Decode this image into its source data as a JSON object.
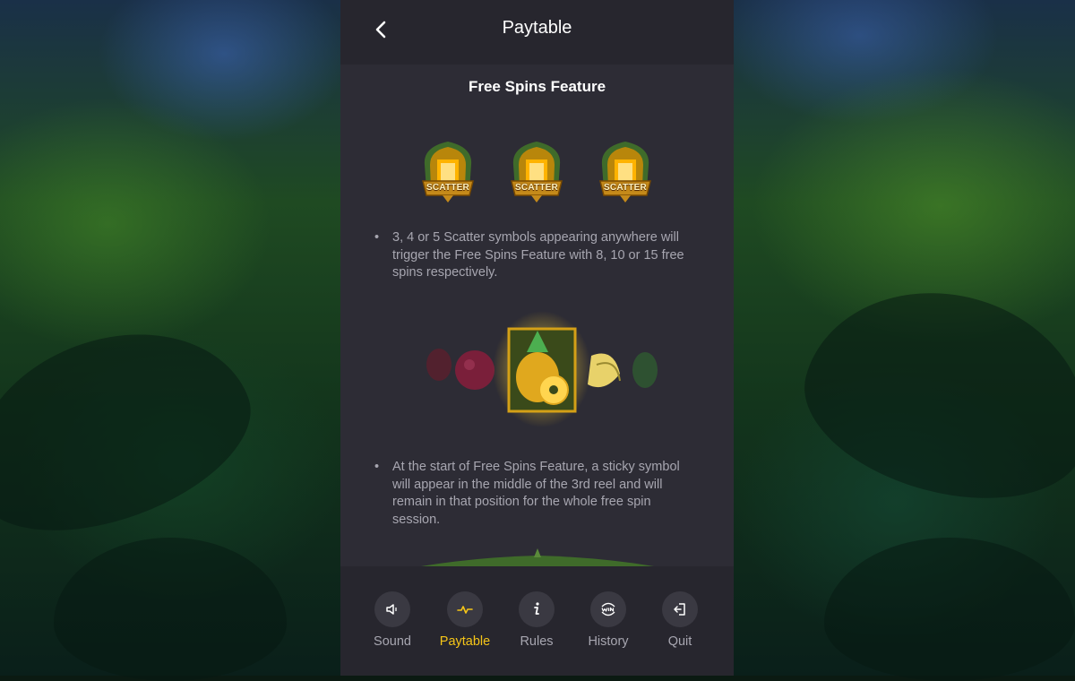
{
  "header": {
    "title": "Paytable"
  },
  "section": {
    "title": "Free Spins Feature",
    "scatter_label": "SCATTER",
    "bullet1": "3, 4 or 5 Scatter symbols appearing anywhere will trigger the Free Spins Feature with 8, 10 or 15 free spins respectively.",
    "bullet2": "At the start of Free Spins Feature, a sticky symbol will appear in the middle of the 3rd reel and will remain in that position for the whole free spin session."
  },
  "nav": {
    "items": [
      {
        "label": "Sound",
        "icon": "sound-icon"
      },
      {
        "label": "Paytable",
        "icon": "paytable-icon",
        "active": true
      },
      {
        "label": "Rules",
        "icon": "info-icon"
      },
      {
        "label": "History",
        "icon": "win-history-icon"
      },
      {
        "label": "Quit",
        "icon": "quit-icon"
      }
    ]
  },
  "colors": {
    "panel": "#2d2c35",
    "header": "#27262e",
    "active": "#f5c518",
    "muted_text": "#a7a6b0"
  }
}
